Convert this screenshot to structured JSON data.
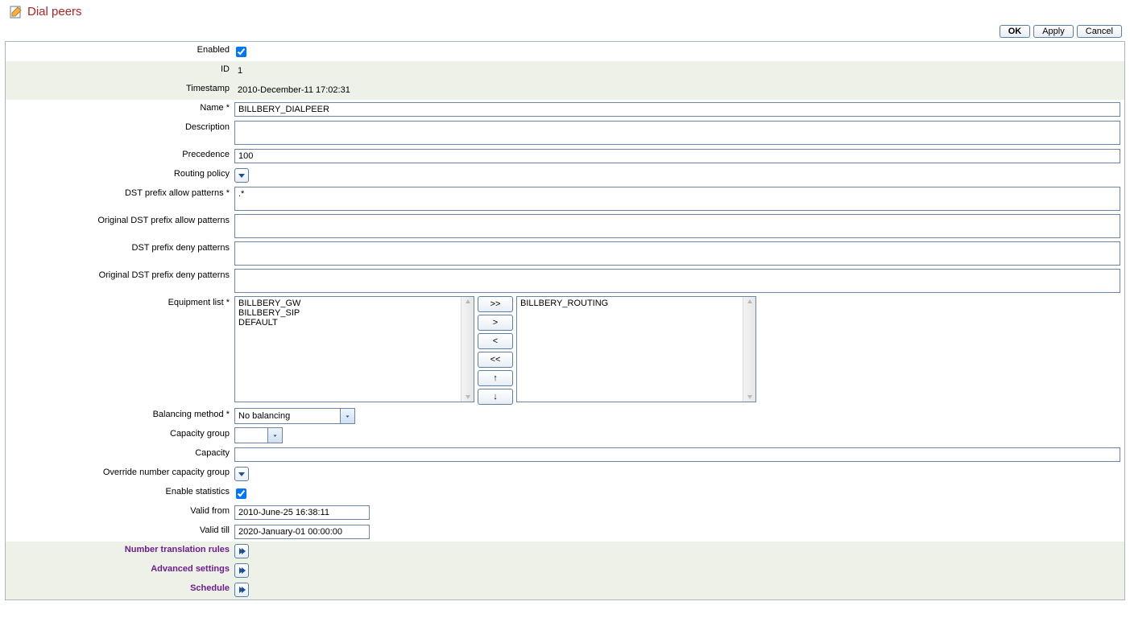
{
  "header": {
    "title": "Dial peers"
  },
  "actions": {
    "ok": "OK",
    "apply": "Apply",
    "cancel": "Cancel"
  },
  "labels": {
    "enabled": "Enabled",
    "id": "ID",
    "timestamp": "Timestamp",
    "name": "Name  *",
    "description": "Description",
    "precedence": "Precedence",
    "routing_policy": "Routing policy",
    "dst_allow": "DST prefix allow patterns  *",
    "orig_dst_allow": "Original DST prefix allow patterns",
    "dst_deny": "DST prefix deny patterns",
    "orig_dst_deny": "Original DST prefix deny patterns",
    "equipment_list": "Equipment list  *",
    "balancing": "Balancing method  *",
    "capacity_group": "Capacity group",
    "capacity": "Capacity",
    "override_cap": "Override number capacity group",
    "enable_stats": "Enable statistics",
    "valid_from": "Valid from",
    "valid_till": "Valid till",
    "ntr": "Number translation rules",
    "adv": "Advanced settings",
    "schedule": "Schedule"
  },
  "values": {
    "enabled": true,
    "id": "1",
    "timestamp": "2010-December-11 17:02:31",
    "name": "BILLBERY_DIALPEER",
    "description": "",
    "precedence": "100",
    "dst_allow": ".*",
    "orig_dst_allow": "",
    "dst_deny": "",
    "orig_dst_deny": "",
    "equipment_available": [
      "BILLBERY_GW",
      "BILLBERY_SIP",
      "DEFAULT"
    ],
    "equipment_selected": [
      "BILLBERY_ROUTING"
    ],
    "balancing": "No balancing",
    "capacity_group": "",
    "capacity": "",
    "enable_stats": true,
    "valid_from": "2010-June-25 16:38:11",
    "valid_till": "2020-January-01 00:00:00"
  },
  "movers": {
    "all_right": ">>",
    "right": ">",
    "left": "<",
    "all_left": "<<",
    "up": "↑",
    "down": "↓"
  }
}
